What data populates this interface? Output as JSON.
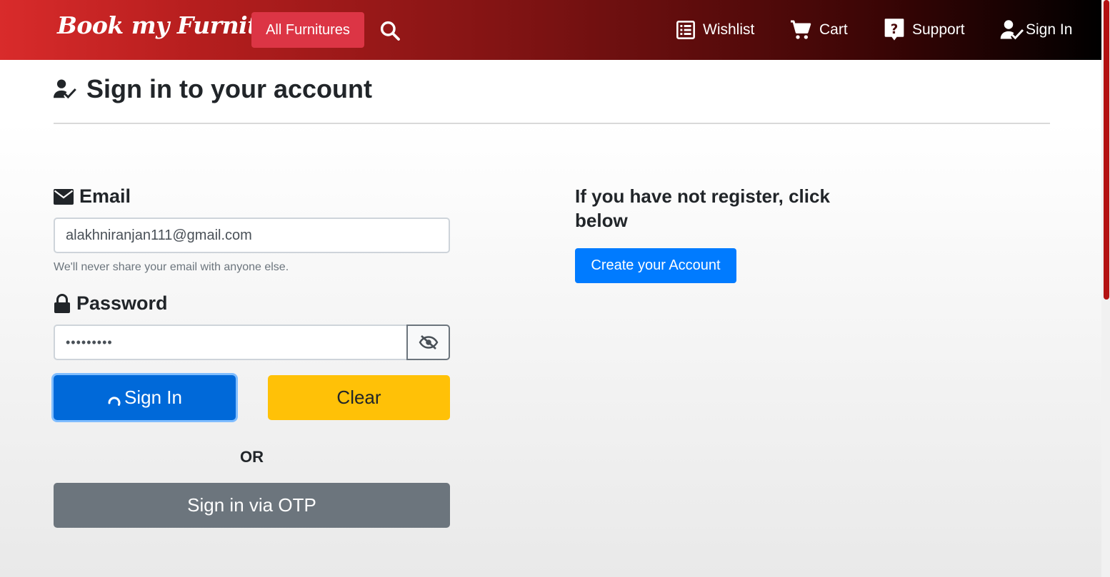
{
  "navbar": {
    "brand": "Book my Furniture",
    "all_furnitures": "All Furnitures",
    "wishlist": "Wishlist",
    "cart": "Cart",
    "support": "Support",
    "sign_in": "Sign In"
  },
  "page": {
    "title": "Sign in to your account"
  },
  "form": {
    "email_label": "Email",
    "email_value": "alakhniranjan111@gmail.com",
    "email_help": "We'll never share your email with anyone else.",
    "password_label": "Password",
    "password_value": "•••••••••",
    "signin_button": "Sign In",
    "clear_button": "Clear",
    "or_text": "OR",
    "otp_button": "Sign in via OTP"
  },
  "register": {
    "text": "If you have not register, click below",
    "create_button": "Create your Account"
  },
  "colors": {
    "primary": "#007bff",
    "warning": "#ffc107",
    "secondary": "#6c757d",
    "danger": "#dc3545"
  },
  "icons": [
    "search-icon",
    "wishlist-icon",
    "cart-icon",
    "support-icon",
    "user-check-icon",
    "envelope-icon",
    "lock-icon",
    "eye-slash-icon",
    "spinner-icon"
  ]
}
